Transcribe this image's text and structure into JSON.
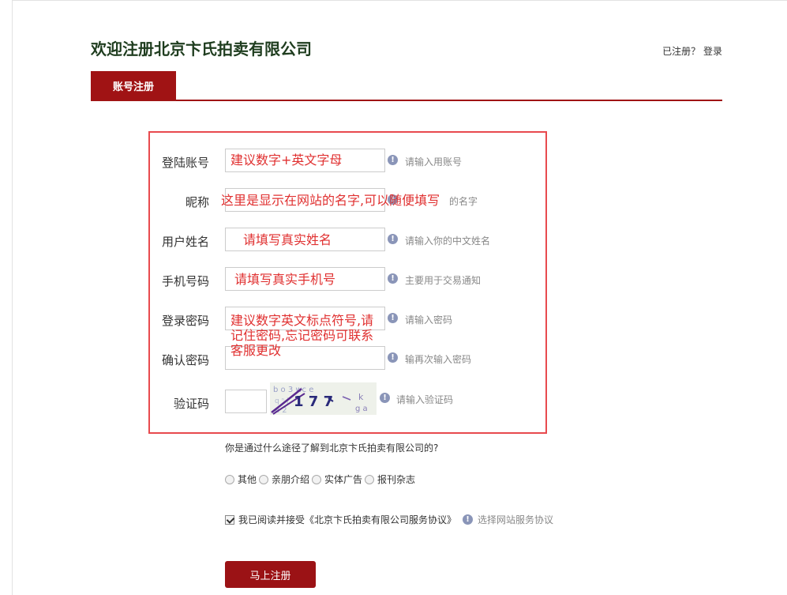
{
  "header": {
    "title": "欢迎注册北京卞氏拍卖有限公司",
    "already_registered": "已注册？",
    "login_label": "登录"
  },
  "tab": {
    "label": "账号注册"
  },
  "fields": {
    "account": {
      "label": "登陆账号",
      "hint": "请输入用账号",
      "note": "建议数字+英文字母"
    },
    "nickname": {
      "label": "昵称",
      "hint": "的名字",
      "note": "这里是显示在网站的名字,可以随便填写"
    },
    "realname": {
      "label": "用户姓名",
      "hint": "请输入你的中文姓名",
      "note": "请填写真实姓名"
    },
    "phone": {
      "label": "手机号码",
      "hint": "主要用于交易通知",
      "note": "请填写真实手机号"
    },
    "password": {
      "label": "登录密码",
      "hint": "请输入密码",
      "note_lines": [
        "建议数字英文标点符号,请",
        "记住密码,忘记密码可联系",
        "客服更改"
      ]
    },
    "confirm": {
      "label": "确认密码",
      "hint": "输再次输入密码"
    },
    "captcha": {
      "label": "验证码",
      "hint": "请输入验证码",
      "image_text": "1 7 7"
    }
  },
  "info_icon": {
    "glyph": "!"
  },
  "survey": {
    "question": "你是通过什么途径了解到北京卞氏拍卖有限公司的?",
    "options": [
      "其他",
      "亲朋介绍",
      "实体广告",
      "报刊杂志"
    ]
  },
  "agreement": {
    "text": "我已阅读并接受《北京卞氏拍卖有限公司服务协议》",
    "hint": "选择网站服务协议",
    "checked": true
  },
  "submit": {
    "label": "马上注册"
  },
  "colors": {
    "brand": "#a01314",
    "annotation": "#e03030",
    "highlight_box": "#e84a4e",
    "info_icon": "#8a95b8"
  }
}
